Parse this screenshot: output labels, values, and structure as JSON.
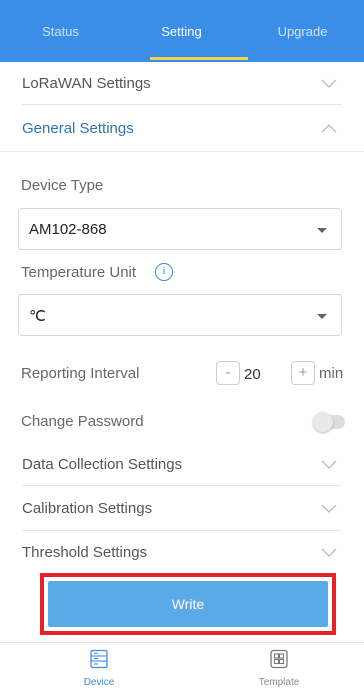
{
  "tabs": [
    {
      "label": "Status"
    },
    {
      "label": "Setting"
    },
    {
      "label": "Upgrade"
    }
  ],
  "sections": {
    "lorawan": {
      "title": "LoRaWAN Settings"
    },
    "general": {
      "title": "General Settings"
    },
    "data_collection": {
      "title": "Data Collection Settings"
    },
    "calibration": {
      "title": "Calibration Settings"
    },
    "threshold": {
      "title": "Threshold Settings"
    }
  },
  "general": {
    "device_type_label": "Device Type",
    "device_type_value": "AM102-868",
    "temp_unit_label": "Temperature Unit",
    "temp_unit_value": "℃",
    "info_glyph": "i",
    "reporting_interval_label": "Reporting Interval",
    "reporting_interval_value": "20",
    "reporting_interval_unit": "min",
    "minus_glyph": "-",
    "plus_glyph": "+",
    "change_password_label": "Change Password"
  },
  "write_button": {
    "label": "Write"
  },
  "bottom_nav": [
    {
      "label": "Device",
      "icon": "device-icon"
    },
    {
      "label": "Template",
      "icon": "template-icon"
    }
  ],
  "colors": {
    "primary": "#3a8ee6",
    "accent_underline": "#f3d14b",
    "highlight_border": "#e8202a",
    "write_button": "#5aaae8"
  }
}
